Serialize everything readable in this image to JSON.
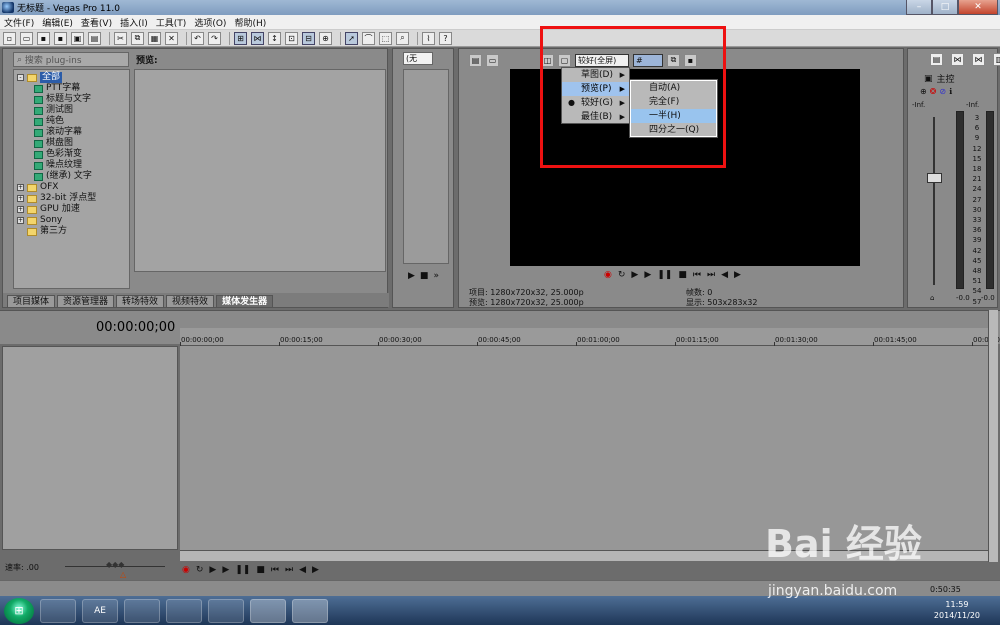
{
  "window": {
    "title": "无标题 - Vegas Pro 11.0",
    "controls": [
      "–",
      "□",
      "✕"
    ]
  },
  "menu": [
    "文件(F)",
    "编辑(E)",
    "查看(V)",
    "插入(I)",
    "工具(T)",
    "选项(O)",
    "帮助(H)"
  ],
  "explorer": {
    "search_placeholder": "搜索 plug-ins",
    "preview_label": "预览:",
    "tree": [
      {
        "label": "全部",
        "type": "folder",
        "level": 0,
        "expander": "-"
      },
      {
        "label": "PTT字幕",
        "type": "gen",
        "level": 1
      },
      {
        "label": "标题与文字",
        "type": "gen",
        "level": 1
      },
      {
        "label": "测试图",
        "type": "gen",
        "level": 1
      },
      {
        "label": "纯色",
        "type": "gen",
        "level": 1
      },
      {
        "label": "滚动字幕",
        "type": "gen",
        "level": 1
      },
      {
        "label": "棋盘图",
        "type": "gen",
        "level": 1
      },
      {
        "label": "色彩渐变",
        "type": "gen",
        "level": 1
      },
      {
        "label": "噪点纹理",
        "type": "gen",
        "level": 1
      },
      {
        "label": "(继承) 文字",
        "type": "gen",
        "level": 1
      },
      {
        "label": "OFX",
        "type": "folder",
        "level": 0,
        "expander": "+"
      },
      {
        "label": "32-bit 浮点型",
        "type": "folder",
        "level": 0,
        "expander": "+"
      },
      {
        "label": "GPU 加速",
        "type": "folder",
        "level": 0,
        "expander": "+"
      },
      {
        "label": "Sony",
        "type": "folder",
        "level": 0,
        "expander": "+"
      },
      {
        "label": "第三方",
        "type": "folder",
        "level": 0,
        "expander": ""
      }
    ],
    "tabs": [
      "项目媒体",
      "资源管理器",
      "转场特效",
      "视频特效",
      "媒体发生器"
    ],
    "active_tab": 4
  },
  "trimmer": {
    "select_value": "(无"
  },
  "video_preview": {
    "quality_value": "较好(全屏)",
    "info_project": "项目: 1280x720x32, 25.000p",
    "info_preview": "预览: 1280x720x32, 25.000p",
    "info_frame": "帧数: 0",
    "info_display": "显示: 503x283x32"
  },
  "quality_menu": {
    "items": [
      {
        "label": "草图(D)",
        "highlighted": false,
        "checked": false
      },
      {
        "label": "预览(P)",
        "highlighted": true,
        "checked": false
      },
      {
        "label": "较好(G)",
        "highlighted": false,
        "checked": true
      },
      {
        "label": "最佳(B)",
        "highlighted": false,
        "checked": false
      }
    ],
    "submenu": [
      {
        "label": "自动(A)",
        "highlighted": false
      },
      {
        "label": "完全(F)",
        "highlighted": false
      },
      {
        "label": "一半(H)",
        "highlighted": true
      },
      {
        "label": "四分之一(Q)",
        "highlighted": false
      }
    ]
  },
  "mixer": {
    "master_label": "主控",
    "inf_left": "-Inf.",
    "inf_right": "-Inf.",
    "scale": [
      "3",
      "6",
      "9",
      "12",
      "15",
      "18",
      "21",
      "24",
      "27",
      "30",
      "33",
      "36",
      "39",
      "42",
      "45",
      "48",
      "51",
      "54",
      "57"
    ],
    "bottom_left": "-0.0",
    "bottom_right": "-0.0"
  },
  "timeline": {
    "timecode": "00:00:00;00",
    "ruler": [
      "00:00:00;00",
      "00:00:15;00",
      "00:00:30;00",
      "00:00:45;00",
      "00:01:00;00",
      "00:01:15;00",
      "00:01:30;00",
      "00:01:45;00",
      "00:02:0"
    ],
    "speed_label": "速率: .00",
    "status_time": "0:50:35"
  },
  "taskbar": {
    "apps": [
      "AE",
      "",
      "",
      "",
      "",
      ""
    ],
    "clock_time": "11:59",
    "clock_date": "2014/11/20"
  },
  "watermark": {
    "brand": "Bai 经验",
    "url": "jingyan.baidu.com"
  }
}
